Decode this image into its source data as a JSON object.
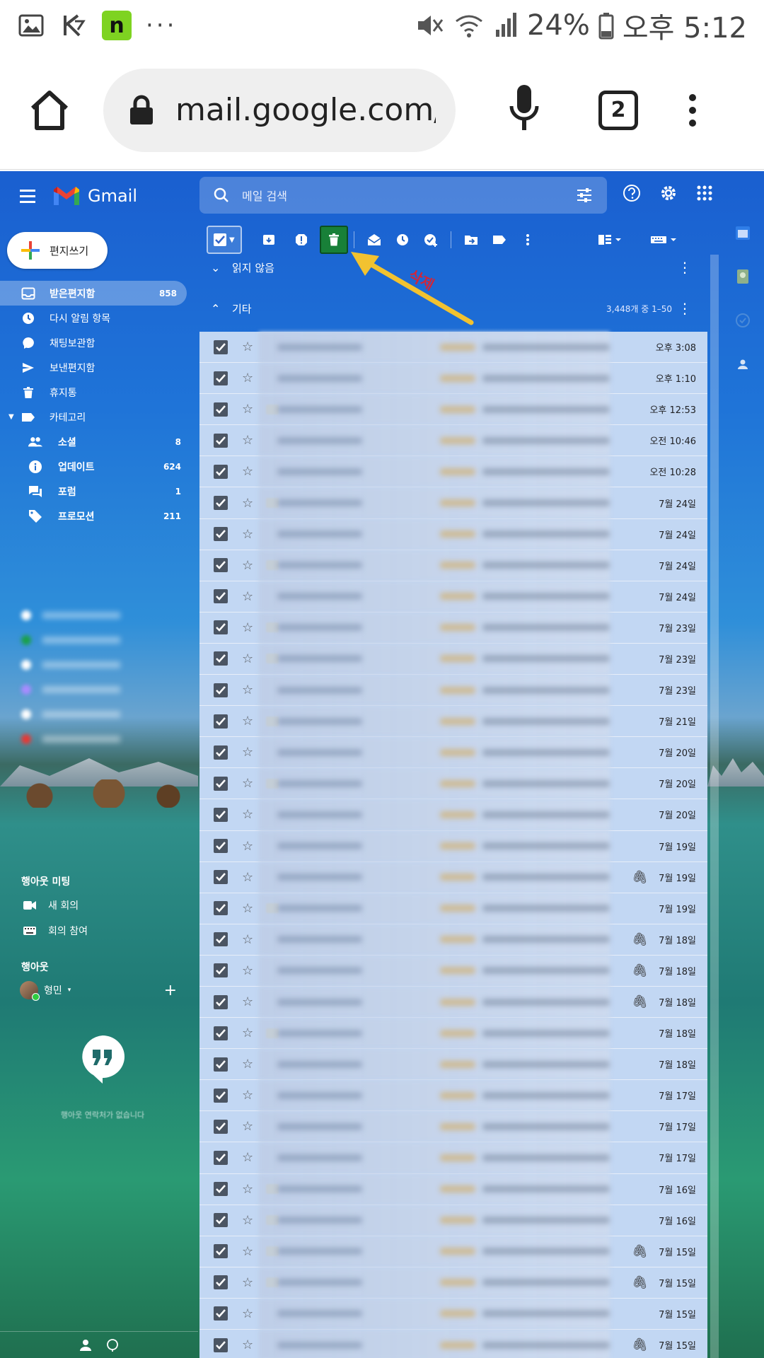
{
  "status_bar": {
    "battery": "24%",
    "time": "오후 5:12",
    "n_badge": "n",
    "more": "···"
  },
  "browser": {
    "url": "mail.google.com/",
    "tab_count": "2"
  },
  "gmail": {
    "logo_text": "Gmail",
    "search_placeholder": "메일 검색",
    "compose_label": "편지쓰기",
    "nav": [
      {
        "label": "받은편지함",
        "count": "858",
        "icon": "inbox-icon"
      },
      {
        "label": "다시 알림 항목",
        "count": "",
        "icon": "clock-icon"
      },
      {
        "label": "채팅보관함",
        "count": "",
        "icon": "chat-icon"
      },
      {
        "label": "보낸편지함",
        "count": "",
        "icon": "send-icon"
      },
      {
        "label": "휴지통",
        "count": "",
        "icon": "trash-icon"
      },
      {
        "label": "카테고리",
        "count": "",
        "icon": "label-icon"
      }
    ],
    "categories": [
      {
        "label": "소셜",
        "count": "8",
        "icon": "people-icon"
      },
      {
        "label": "업데이트",
        "count": "624",
        "icon": "info-icon"
      },
      {
        "label": "포럼",
        "count": "1",
        "icon": "forum-icon"
      },
      {
        "label": "프로모션",
        "count": "211",
        "icon": "tag-icon"
      }
    ],
    "meet": {
      "title": "행아웃 미팅",
      "new_meeting": "새 회의",
      "join_meeting": "회의 참여"
    },
    "hangouts": {
      "title": "행아웃",
      "user": "형민",
      "empty_text": "행아웃 연락처가 없습니다"
    },
    "annotation": "삭제",
    "sections": {
      "unread": "읽지 않음",
      "other": "기타",
      "range": "3,448개 중 1–50"
    },
    "emails": [
      {
        "date": "오후 3:08",
        "important": false,
        "attach": false
      },
      {
        "date": "오후 1:10",
        "important": false,
        "attach": false
      },
      {
        "date": "오후 12:53",
        "important": true,
        "attach": false
      },
      {
        "date": "오전 10:46",
        "important": false,
        "attach": false
      },
      {
        "date": "오전 10:28",
        "important": false,
        "attach": false
      },
      {
        "date": "7월 24일",
        "important": true,
        "attach": false
      },
      {
        "date": "7월 24일",
        "important": false,
        "attach": false
      },
      {
        "date": "7월 24일",
        "important": true,
        "attach": false
      },
      {
        "date": "7월 24일",
        "important": false,
        "attach": false
      },
      {
        "date": "7월 23일",
        "important": true,
        "attach": false
      },
      {
        "date": "7월 23일",
        "important": true,
        "attach": false
      },
      {
        "date": "7월 23일",
        "important": false,
        "attach": false
      },
      {
        "date": "7월 21일",
        "important": true,
        "attach": false
      },
      {
        "date": "7월 20일",
        "important": false,
        "attach": false
      },
      {
        "date": "7월 20일",
        "important": true,
        "attach": false
      },
      {
        "date": "7월 20일",
        "important": false,
        "attach": false
      },
      {
        "date": "7월 19일",
        "important": false,
        "attach": false
      },
      {
        "date": "7월 19일",
        "important": false,
        "attach": true
      },
      {
        "date": "7월 19일",
        "important": true,
        "attach": false
      },
      {
        "date": "7월 18일",
        "important": false,
        "attach": true
      },
      {
        "date": "7월 18일",
        "important": false,
        "attach": true
      },
      {
        "date": "7월 18일",
        "important": false,
        "attach": true
      },
      {
        "date": "7월 18일",
        "important": true,
        "attach": false
      },
      {
        "date": "7월 18일",
        "important": false,
        "attach": false
      },
      {
        "date": "7월 17일",
        "important": false,
        "attach": false
      },
      {
        "date": "7월 17일",
        "important": false,
        "attach": false
      },
      {
        "date": "7월 17일",
        "important": false,
        "attach": false
      },
      {
        "date": "7월 16일",
        "important": true,
        "attach": false
      },
      {
        "date": "7월 16일",
        "important": true,
        "attach": false
      },
      {
        "date": "7월 15일",
        "important": true,
        "attach": true
      },
      {
        "date": "7월 15일",
        "important": true,
        "attach": true
      },
      {
        "date": "7월 15일",
        "important": false,
        "attach": false
      },
      {
        "date": "7월 15일",
        "important": false,
        "attach": true
      }
    ]
  },
  "colors": {
    "delete_highlight": "#188038",
    "arrow": "#f2c230",
    "annotation_text": "#d0263a"
  }
}
